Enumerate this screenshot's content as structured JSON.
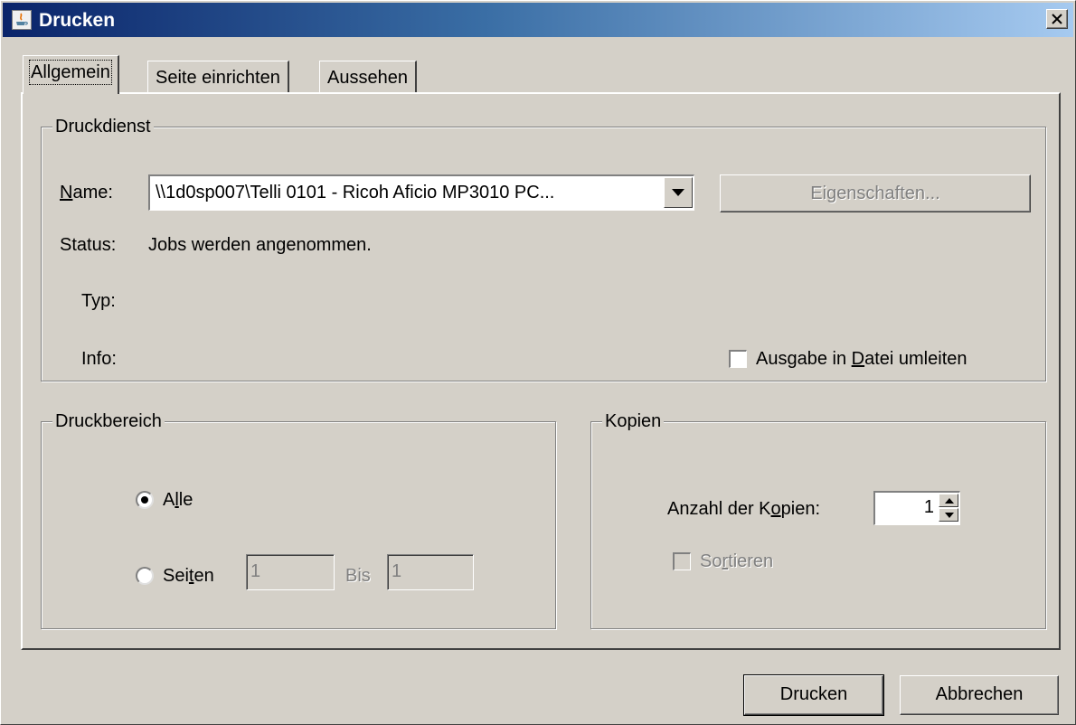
{
  "window": {
    "title": "Drucken"
  },
  "tabs": [
    {
      "label": "Allgemein",
      "active": true
    },
    {
      "label": "Seite einrichten",
      "active": false
    },
    {
      "label": "Aussehen",
      "active": false
    }
  ],
  "druckdienst": {
    "group_title": "Druckdienst",
    "name_label": "Name:",
    "printer_selected": "\\\\1d0sp007\\Telli 0101 - Ricoh Aficio MP3010 PC...",
    "properties_button": "Eigenschaften...",
    "status_label": "Status:",
    "status_value": "Jobs werden angenommen.",
    "type_label": "Typ:",
    "info_label": "Info:",
    "print_to_file_label": "Ausgabe in Datei umleiten",
    "print_to_file_checked": false
  },
  "druckbereich": {
    "group_title": "Druckbereich",
    "all_label": "Alle",
    "all_selected": true,
    "pages_label": "Seiten",
    "from_value": "1",
    "to_label": "Bis",
    "to_value": "1"
  },
  "kopien": {
    "group_title": "Kopien",
    "count_label": "Anzahl der Kopien:",
    "count_value": "1",
    "collate_label": "Sortieren",
    "collate_checked": false
  },
  "footer": {
    "print_button": "Drucken",
    "cancel_button": "Abbrechen"
  }
}
